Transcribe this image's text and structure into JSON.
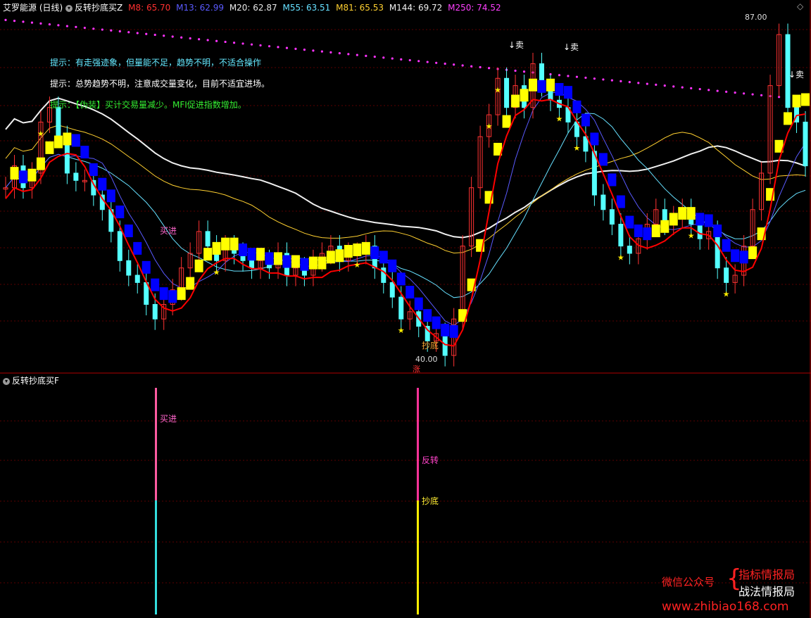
{
  "main_header": {
    "title": "艾罗能源",
    "period": "(日线)",
    "indicator": "反转抄底买Z",
    "ma": [
      {
        "label": "M8: 65.70",
        "color": "#ff3030"
      },
      {
        "label": "M13: 62.99",
        "color": "#3a3aff"
      },
      {
        "label": "M20: 62.87",
        "color": "#e8e8e8"
      },
      {
        "label": "M55: 63.51",
        "color": "#66e0ff"
      },
      {
        "label": "M81: 65.53",
        "color": "#ffd030"
      },
      {
        "label": "M144: 69.72",
        "color": "#f0f0f0"
      },
      {
        "label": "M250: 74.52",
        "color": "#ff40ff"
      }
    ]
  },
  "hints": [
    {
      "text": "提示：有走强迹象，但量能不足，趋势不明，不适合操作",
      "color": "#66e8ff"
    },
    {
      "text": "提示：总势趋势不明，注意成交量变化，目前不适宜进场。",
      "color": "#ffffff"
    },
    {
      "text": "提示：【伪装】买计交易量减少。MFI促进指数增加。",
      "color": "#33ee33"
    }
  ],
  "price_labels": {
    "high": "87.00",
    "low": "40.00"
  },
  "sub_header": {
    "title": "反转抄底买F"
  },
  "signals": {
    "main_buy": "买进",
    "main_bottom": "抄底",
    "zhang": "涨",
    "sell": "↓卖",
    "sub_buy": "买进",
    "sub_reverse": "反转",
    "sub_bottom": "抄底"
  },
  "watermark": {
    "left": "微信公众号",
    "line1": "指标情报局",
    "line2": "战法情报局",
    "url": "www.zhibiao168.com"
  },
  "colors": {
    "up": "#ff3232",
    "down": "#54ffff",
    "sell_dots": "#ff33ff",
    "yellow": "#ffff00",
    "blue": "#0000ff",
    "red": "#ff0000"
  },
  "chart_data": {
    "type": "candlestick",
    "ylim": [
      40,
      87
    ],
    "series": [
      {
        "name": "K线",
        "closes": [
          63,
          66,
          63,
          65,
          72,
          74,
          70,
          65,
          64,
          64,
          62,
          60,
          57,
          53,
          51,
          50,
          47,
          45,
          47,
          49,
          52,
          54,
          57,
          55,
          53,
          55,
          54,
          53,
          52,
          53,
          52,
          54,
          51,
          52,
          51,
          53,
          54,
          55,
          53,
          54,
          54,
          55,
          52,
          50,
          48,
          45,
          46,
          44,
          42,
          43,
          40,
          45,
          55,
          63,
          70,
          73,
          78,
          74,
          77,
          74,
          80,
          77,
          75,
          74,
          72,
          70,
          68,
          62,
          60,
          58,
          55,
          54,
          56,
          58,
          60,
          58,
          59,
          60,
          58,
          56,
          57,
          52,
          50,
          51,
          55,
          60,
          65,
          77,
          84,
          74,
          72,
          66
        ]
      }
    ]
  }
}
